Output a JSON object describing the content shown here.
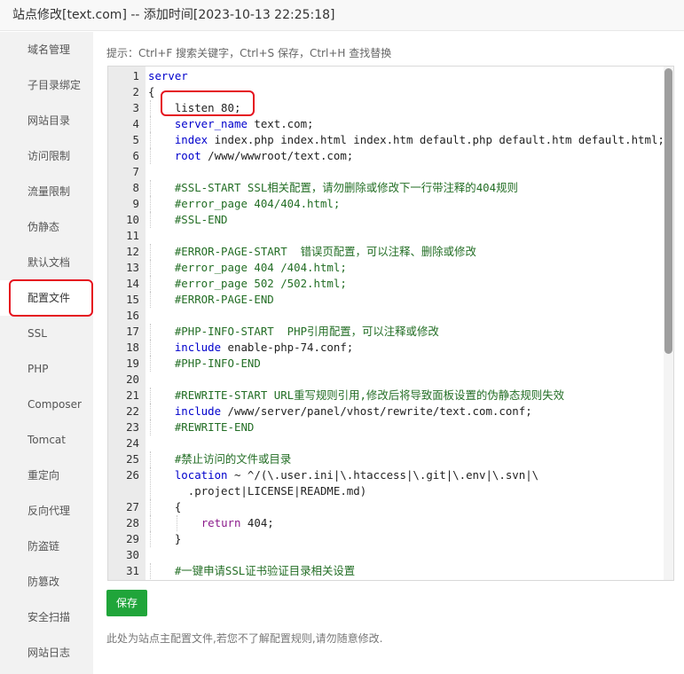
{
  "window": {
    "title": "站点修改[text.com] -- 添加时间[2023-10-13 22:25:18]"
  },
  "sidebar": {
    "items": [
      {
        "label": "域名管理"
      },
      {
        "label": "子目录绑定"
      },
      {
        "label": "网站目录"
      },
      {
        "label": "访问限制"
      },
      {
        "label": "流量限制"
      },
      {
        "label": "伪静态"
      },
      {
        "label": "默认文档"
      },
      {
        "label": "配置文件",
        "active": true
      },
      {
        "label": "SSL"
      },
      {
        "label": "PHP"
      },
      {
        "label": "Composer"
      },
      {
        "label": "Tomcat"
      },
      {
        "label": "重定向"
      },
      {
        "label": "反向代理"
      },
      {
        "label": "防盗链"
      },
      {
        "label": "防篡改"
      },
      {
        "label": "安全扫描"
      },
      {
        "label": "网站日志"
      }
    ]
  },
  "editor": {
    "hint": "提示：Ctrl+F 搜索关键字，Ctrl+S 保存，Ctrl+H 查找替换",
    "lines": [
      {
        "n": "1",
        "text": "server"
      },
      {
        "n": "2",
        "text": "{"
      },
      {
        "n": "3",
        "text": "    listen 80;"
      },
      {
        "n": "4",
        "text": "    server_name text.com;"
      },
      {
        "n": "5",
        "text": "    index index.php index.html index.htm default.php default.htm default.html;"
      },
      {
        "n": "6",
        "text": "    root /www/wwwroot/text.com;"
      },
      {
        "n": "7",
        "text": ""
      },
      {
        "n": "8",
        "text": "    #SSL-START SSL相关配置，请勿删除或修改下一行带注释的404规则"
      },
      {
        "n": "9",
        "text": "    #error_page 404/404.html;"
      },
      {
        "n": "10",
        "text": "    #SSL-END"
      },
      {
        "n": "11",
        "text": ""
      },
      {
        "n": "12",
        "text": "    #ERROR-PAGE-START  错误页配置，可以注释、删除或修改"
      },
      {
        "n": "13",
        "text": "    #error_page 404 /404.html;"
      },
      {
        "n": "14",
        "text": "    #error_page 502 /502.html;"
      },
      {
        "n": "15",
        "text": "    #ERROR-PAGE-END"
      },
      {
        "n": "16",
        "text": ""
      },
      {
        "n": "17",
        "text": "    #PHP-INFO-START  PHP引用配置，可以注释或修改"
      },
      {
        "n": "18",
        "text": "    include enable-php-74.conf;"
      },
      {
        "n": "19",
        "text": "    #PHP-INFO-END"
      },
      {
        "n": "20",
        "text": ""
      },
      {
        "n": "21",
        "text": "    #REWRITE-START URL重写规则引用,修改后将导致面板设置的伪静态规则失效"
      },
      {
        "n": "22",
        "text": "    include /www/server/panel/vhost/rewrite/text.com.conf;"
      },
      {
        "n": "23",
        "text": "    #REWRITE-END"
      },
      {
        "n": "24",
        "text": ""
      },
      {
        "n": "25",
        "text": "    #禁止访问的文件或目录"
      },
      {
        "n": "26",
        "text": "    location ~ ^/(\\.user.ini|\\.htaccess|\\.git|\\.env|\\.svn|\\",
        "cont": "      .project|LICENSE|README.md)"
      },
      {
        "n": "27",
        "text": "    {"
      },
      {
        "n": "28",
        "text": "        return 404;"
      },
      {
        "n": "29",
        "text": "    }"
      },
      {
        "n": "30",
        "text": ""
      },
      {
        "n": "31",
        "text": "    #一键申请SSL证书验证目录相关设置"
      }
    ]
  },
  "actions": {
    "save_label": "保存"
  },
  "footer": {
    "note": "此处为站点主配置文件,若您不了解配置规则,请勿随意修改."
  },
  "colors": {
    "accent": "#20a53a",
    "highlight": "#e5121f",
    "comment": "#236e25",
    "keyword": "#0000cc"
  }
}
